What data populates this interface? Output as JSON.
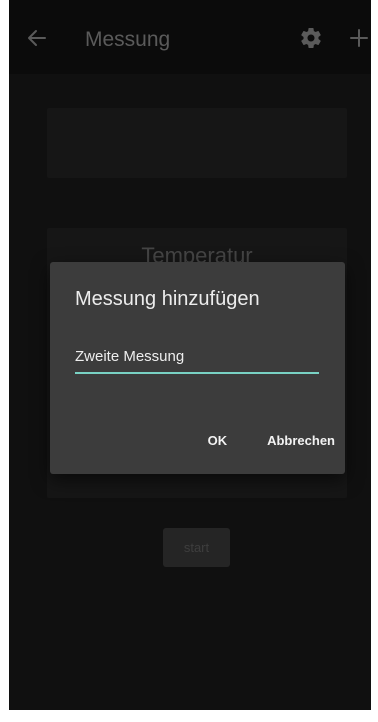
{
  "appbar": {
    "title": "Messung",
    "back_icon": "arrow-left-icon",
    "settings_icon": "gear-icon",
    "add_icon": "plus-icon"
  },
  "main": {
    "card_heading": "Temperatur",
    "start_label": "start"
  },
  "dialog": {
    "title": "Messung hinzufügen",
    "input_value": "Zweite Messung",
    "ok_label": "OK",
    "cancel_label": "Abbrechen"
  },
  "colors": {
    "background": "#1a1a1a",
    "appbar": "#121212",
    "dialog": "#3c3c3c",
    "accent": "#79d2c4"
  }
}
